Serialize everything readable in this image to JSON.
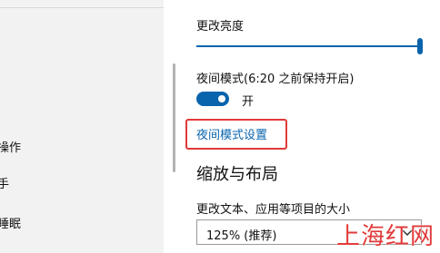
{
  "sidebar": {
    "items": [
      {
        "label": "操作"
      },
      {
        "label": "手"
      },
      {
        "label": "睡眠"
      }
    ]
  },
  "display": {
    "brightness_label": "更改亮度",
    "brightness_value": 100,
    "night_mode_label": "夜间模式(6:20 之前保持开启)",
    "night_mode_state": "开",
    "night_mode_settings_link": "夜间模式设置",
    "scale_heading": "缩放与布局",
    "scale_label": "更改文本、应用等项目的大小",
    "scale_value": "125% (推荐)"
  },
  "watermark": "上海红网",
  "colors": {
    "accent": "#0a64ad",
    "highlight": "#e03a3a",
    "watermark": "#e23b3b",
    "sidebar_bg": "#f2f2f2"
  }
}
